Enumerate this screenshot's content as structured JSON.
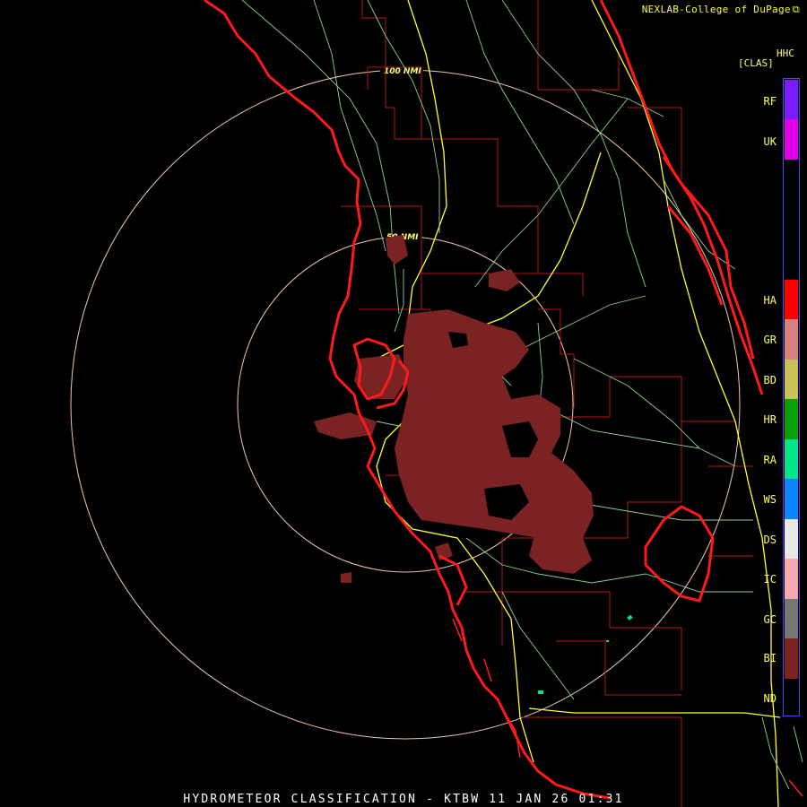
{
  "credit": "NEXLAB-College of DuPage",
  "legend": {
    "product_code": "HHC",
    "class_header": "[CLAS]",
    "classes": [
      {
        "code": "RF",
        "color": "#7a1cff"
      },
      {
        "code": "UK",
        "color": "#e000e6"
      },
      {
        "code": "HA",
        "color": "#ff0000"
      },
      {
        "code": "GR",
        "color": "#d98080"
      },
      {
        "code": "BD",
        "color": "#c9c25a"
      },
      {
        "code": "HR",
        "color": "#0aa00a"
      },
      {
        "code": "RA",
        "color": "#00e688"
      },
      {
        "code": "WS",
        "color": "#0b84ff"
      },
      {
        "code": "DS",
        "color": "#e8e8e8"
      },
      {
        "code": "IC",
        "color": "#f5a8b0"
      },
      {
        "code": "GC",
        "color": "#777777"
      },
      {
        "code": "BI",
        "color": "#7b2222"
      },
      {
        "code": "ND",
        "color": "#000000"
      }
    ]
  },
  "range_rings": [
    {
      "label": "50 NMI"
    },
    {
      "label": "100 NMI"
    }
  ],
  "footer": "HYDROMETEOR CLASSIFICATION - KTBW 11 JAN 26 01:31",
  "colors": {
    "coastline": "#ff1a1a",
    "county_lines": "#b01818",
    "roads_major": "#ffff33",
    "roads_minor": "#8fd08f",
    "range_rings": "#f0c8b0",
    "echo": "#7b2222"
  }
}
